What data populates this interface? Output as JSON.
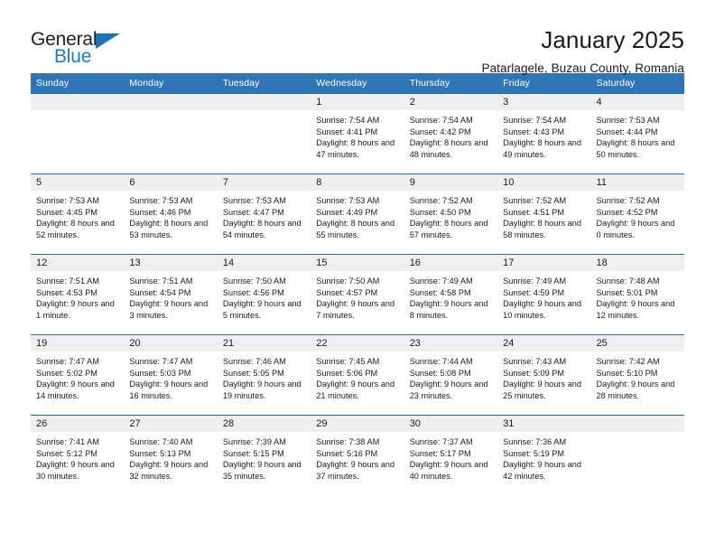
{
  "brand": {
    "name_top": "General",
    "name_bottom": "Blue",
    "triangle_color": "#1d72b8",
    "text_color": "#231f20",
    "blue_color": "#1f7ac4"
  },
  "header": {
    "title": "January 2025",
    "subtitle": "Patarlagele, Buzau County, Romania"
  },
  "theme": {
    "header_bg": "#3075b5",
    "row_divider": "#2e6da4",
    "daynum_bg": "#efefef",
    "text": "#1a1a1a"
  },
  "weekdays": [
    "Sunday",
    "Monday",
    "Tuesday",
    "Wednesday",
    "Thursday",
    "Friday",
    "Saturday"
  ],
  "labels": {
    "sunrise": "Sunrise:",
    "sunset": "Sunset:",
    "daylight": "Daylight:"
  },
  "weeks": [
    [
      {
        "day": "",
        "sunrise": "",
        "sunset": "",
        "daylight": ""
      },
      {
        "day": "",
        "sunrise": "",
        "sunset": "",
        "daylight": ""
      },
      {
        "day": "",
        "sunrise": "",
        "sunset": "",
        "daylight": ""
      },
      {
        "day": "1",
        "sunrise": "Sunrise: 7:54 AM",
        "sunset": "Sunset: 4:41 PM",
        "daylight": "Daylight: 8 hours and 47 minutes."
      },
      {
        "day": "2",
        "sunrise": "Sunrise: 7:54 AM",
        "sunset": "Sunset: 4:42 PM",
        "daylight": "Daylight: 8 hours and 48 minutes."
      },
      {
        "day": "3",
        "sunrise": "Sunrise: 7:54 AM",
        "sunset": "Sunset: 4:43 PM",
        "daylight": "Daylight: 8 hours and 49 minutes."
      },
      {
        "day": "4",
        "sunrise": "Sunrise: 7:53 AM",
        "sunset": "Sunset: 4:44 PM",
        "daylight": "Daylight: 8 hours and 50 minutes."
      }
    ],
    [
      {
        "day": "5",
        "sunrise": "Sunrise: 7:53 AM",
        "sunset": "Sunset: 4:45 PM",
        "daylight": "Daylight: 8 hours and 52 minutes."
      },
      {
        "day": "6",
        "sunrise": "Sunrise: 7:53 AM",
        "sunset": "Sunset: 4:46 PM",
        "daylight": "Daylight: 8 hours and 53 minutes."
      },
      {
        "day": "7",
        "sunrise": "Sunrise: 7:53 AM",
        "sunset": "Sunset: 4:47 PM",
        "daylight": "Daylight: 8 hours and 54 minutes."
      },
      {
        "day": "8",
        "sunrise": "Sunrise: 7:53 AM",
        "sunset": "Sunset: 4:49 PM",
        "daylight": "Daylight: 8 hours and 55 minutes."
      },
      {
        "day": "9",
        "sunrise": "Sunrise: 7:52 AM",
        "sunset": "Sunset: 4:50 PM",
        "daylight": "Daylight: 8 hours and 57 minutes."
      },
      {
        "day": "10",
        "sunrise": "Sunrise: 7:52 AM",
        "sunset": "Sunset: 4:51 PM",
        "daylight": "Daylight: 8 hours and 58 minutes."
      },
      {
        "day": "11",
        "sunrise": "Sunrise: 7:52 AM",
        "sunset": "Sunset: 4:52 PM",
        "daylight": "Daylight: 9 hours and 0 minutes."
      }
    ],
    [
      {
        "day": "12",
        "sunrise": "Sunrise: 7:51 AM",
        "sunset": "Sunset: 4:53 PM",
        "daylight": "Daylight: 9 hours and 1 minute."
      },
      {
        "day": "13",
        "sunrise": "Sunrise: 7:51 AM",
        "sunset": "Sunset: 4:54 PM",
        "daylight": "Daylight: 9 hours and 3 minutes."
      },
      {
        "day": "14",
        "sunrise": "Sunrise: 7:50 AM",
        "sunset": "Sunset: 4:56 PM",
        "daylight": "Daylight: 9 hours and 5 minutes."
      },
      {
        "day": "15",
        "sunrise": "Sunrise: 7:50 AM",
        "sunset": "Sunset: 4:57 PM",
        "daylight": "Daylight: 9 hours and 7 minutes."
      },
      {
        "day": "16",
        "sunrise": "Sunrise: 7:49 AM",
        "sunset": "Sunset: 4:58 PM",
        "daylight": "Daylight: 9 hours and 8 minutes."
      },
      {
        "day": "17",
        "sunrise": "Sunrise: 7:49 AM",
        "sunset": "Sunset: 4:59 PM",
        "daylight": "Daylight: 9 hours and 10 minutes."
      },
      {
        "day": "18",
        "sunrise": "Sunrise: 7:48 AM",
        "sunset": "Sunset: 5:01 PM",
        "daylight": "Daylight: 9 hours and 12 minutes."
      }
    ],
    [
      {
        "day": "19",
        "sunrise": "Sunrise: 7:47 AM",
        "sunset": "Sunset: 5:02 PM",
        "daylight": "Daylight: 9 hours and 14 minutes."
      },
      {
        "day": "20",
        "sunrise": "Sunrise: 7:47 AM",
        "sunset": "Sunset: 5:03 PM",
        "daylight": "Daylight: 9 hours and 16 minutes."
      },
      {
        "day": "21",
        "sunrise": "Sunrise: 7:46 AM",
        "sunset": "Sunset: 5:05 PM",
        "daylight": "Daylight: 9 hours and 19 minutes."
      },
      {
        "day": "22",
        "sunrise": "Sunrise: 7:45 AM",
        "sunset": "Sunset: 5:06 PM",
        "daylight": "Daylight: 9 hours and 21 minutes."
      },
      {
        "day": "23",
        "sunrise": "Sunrise: 7:44 AM",
        "sunset": "Sunset: 5:08 PM",
        "daylight": "Daylight: 9 hours and 23 minutes."
      },
      {
        "day": "24",
        "sunrise": "Sunrise: 7:43 AM",
        "sunset": "Sunset: 5:09 PM",
        "daylight": "Daylight: 9 hours and 25 minutes."
      },
      {
        "day": "25",
        "sunrise": "Sunrise: 7:42 AM",
        "sunset": "Sunset: 5:10 PM",
        "daylight": "Daylight: 9 hours and 28 minutes."
      }
    ],
    [
      {
        "day": "26",
        "sunrise": "Sunrise: 7:41 AM",
        "sunset": "Sunset: 5:12 PM",
        "daylight": "Daylight: 9 hours and 30 minutes."
      },
      {
        "day": "27",
        "sunrise": "Sunrise: 7:40 AM",
        "sunset": "Sunset: 5:13 PM",
        "daylight": "Daylight: 9 hours and 32 minutes."
      },
      {
        "day": "28",
        "sunrise": "Sunrise: 7:39 AM",
        "sunset": "Sunset: 5:15 PM",
        "daylight": "Daylight: 9 hours and 35 minutes."
      },
      {
        "day": "29",
        "sunrise": "Sunrise: 7:38 AM",
        "sunset": "Sunset: 5:16 PM",
        "daylight": "Daylight: 9 hours and 37 minutes."
      },
      {
        "day": "30",
        "sunrise": "Sunrise: 7:37 AM",
        "sunset": "Sunset: 5:17 PM",
        "daylight": "Daylight: 9 hours and 40 minutes."
      },
      {
        "day": "31",
        "sunrise": "Sunrise: 7:36 AM",
        "sunset": "Sunset: 5:19 PM",
        "daylight": "Daylight: 9 hours and 42 minutes."
      },
      {
        "day": "",
        "sunrise": "",
        "sunset": "",
        "daylight": ""
      }
    ]
  ]
}
